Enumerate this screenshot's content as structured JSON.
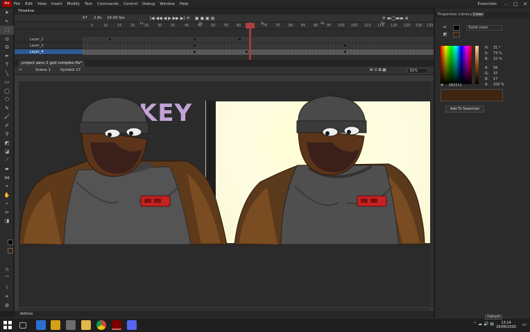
{
  "app": {
    "logo": "An"
  },
  "menu": [
    "File",
    "Edit",
    "View",
    "Insert",
    "Modify",
    "Text",
    "Commands",
    "Control",
    "Debug",
    "Window",
    "Help"
  ],
  "workspace": "Essentials",
  "timeline": {
    "panel_label": "Timeline",
    "frame_number": "67",
    "fps": "24.00 fps",
    "elapsed": "2.8s",
    "ruler": [
      "1s",
      "5",
      "10",
      "15",
      "20",
      "25",
      "30",
      "35",
      "40",
      "45",
      "50",
      "2s",
      "55",
      "60",
      "65",
      "70",
      "75",
      "3s",
      "80",
      "85",
      "90",
      "4s",
      "95",
      "100",
      "105",
      "110",
      "5s",
      "115",
      "120",
      "125",
      "130",
      "135"
    ],
    "layers": [
      {
        "name": "Layer_2"
      },
      {
        "name": "Layer_3"
      },
      {
        "name": "Layer_4"
      }
    ]
  },
  "document": {
    "tab": "project aaru 2 god complex.fla*",
    "scene": "Scene 1",
    "symbol": "Symbol 27",
    "zoom": "82%"
  },
  "stage": {
    "key_text": "KEY"
  },
  "actions_label": "Actions",
  "right_panel": {
    "tabs": [
      "Properties",
      "Library",
      "Color"
    ],
    "fill_type": "Solid color",
    "hsb": {
      "h_label": "H:",
      "h_value": "31 °",
      "s_label": "S:",
      "s_value": "73 %",
      "b_label": "B:",
      "b_value": "22 %"
    },
    "rgb": {
      "r_label": "R:",
      "r_value": "56",
      "g_label": "G:",
      "g_value": "37",
      "b_label": "B:",
      "b_value": "17"
    },
    "alpha": {
      "label": "A:",
      "value": "100 %"
    },
    "hex_label": "#",
    "hex": "382511",
    "add_to_swatches": "Add To Swatches",
    "preview_color": "#3d2511"
  },
  "taskbar": {
    "notification": "Hubspot",
    "time": "13:14",
    "date": "20/06/2020"
  },
  "colors": {
    "accent": "#2c5a92",
    "playhead": "#a63a3a",
    "skin": "#6b3f1d",
    "shirt": "#545454"
  }
}
